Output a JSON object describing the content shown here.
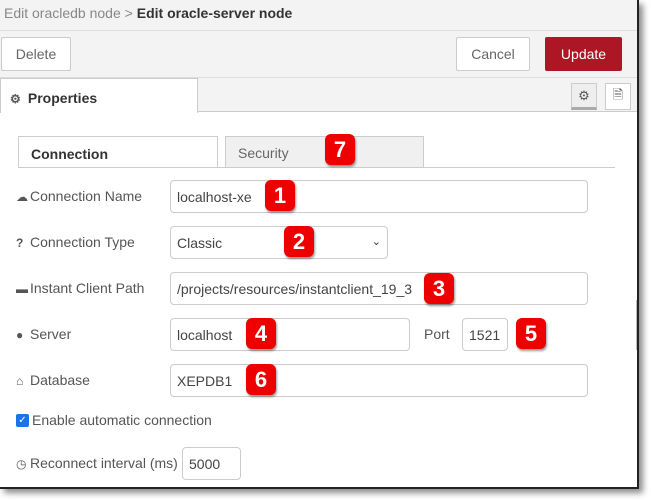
{
  "header": {
    "parent": "Edit oracledb node",
    "separator": ">",
    "title": "Edit oracle-server node"
  },
  "toolbar": {
    "delete": "Delete",
    "cancel": "Cancel",
    "update": "Update"
  },
  "colors": {
    "update": "#ad1625",
    "badge": "#e00000"
  },
  "tabs": {
    "properties": "Properties"
  },
  "subtabs": {
    "connection": "Connection",
    "security": "Security"
  },
  "form": {
    "connection_name": {
      "label": "Connection Name",
      "value": "localhost-xe"
    },
    "connection_type": {
      "label": "Connection Type",
      "value": "Classic"
    },
    "instant_client": {
      "label": "Instant Client Path",
      "value": "/projects/resources/instantclient_19_3"
    },
    "server": {
      "label": "Server",
      "value": "localhost"
    },
    "port": {
      "label": "Port",
      "value": "1521"
    },
    "database": {
      "label": "Database",
      "value": "XEPDB1"
    },
    "auto_connect": {
      "label": "Enable automatic connection",
      "checked": true
    },
    "reconnect": {
      "label": "Reconnect interval (ms)",
      "value": "5000"
    }
  },
  "badges": [
    "1",
    "2",
    "3",
    "4",
    "5",
    "6",
    "7"
  ]
}
